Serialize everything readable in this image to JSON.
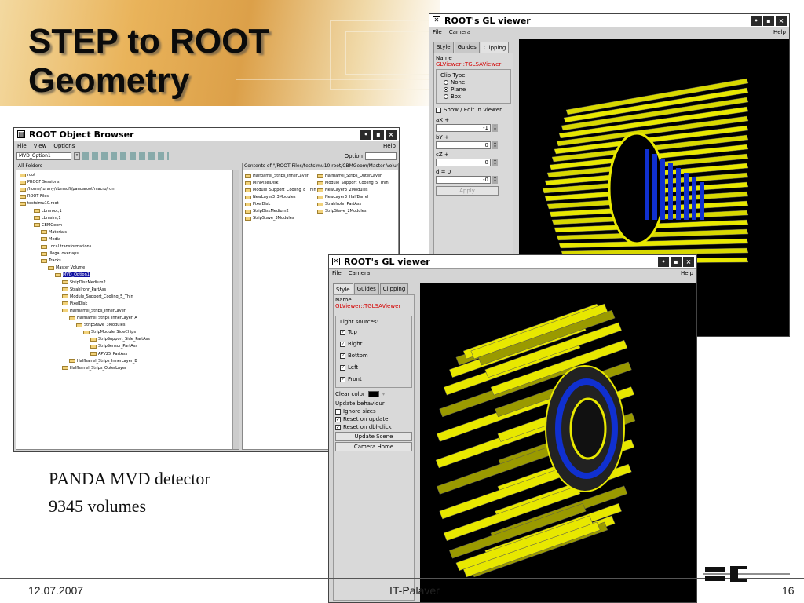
{
  "slide": {
    "title_line1": "STEP to ROOT",
    "title_line2": "Geometry",
    "caption_line1": "PANDA MVD detector",
    "caption_line2": "9345 volumes",
    "date": "12.07.2007",
    "footer": "IT-Palaver",
    "page": "16",
    "logo": "SI"
  },
  "browser": {
    "title": "ROOT Object Browser",
    "menu": [
      "File",
      "View",
      "Options"
    ],
    "help": "Help",
    "combo": "MVD_Option1",
    "option_label": "Option",
    "left_header": "All Folders",
    "right_header": "Contents of \"/ROOT Files/testsimu10.root/CBMGeom/Master Volume",
    "tree": [
      "root",
      "PROOF Sessions",
      "/home/turany/cbmsoft/pandaroot/macro/run",
      "ROOT Files",
      "testsimu10.root",
      "cbmroot;1",
      "cbmsim;1",
      "CBMGeom",
      "Materials",
      "Media",
      "Local transformations",
      "Illegal overlaps",
      "Tracks",
      "Master Volume",
      "MVD_Option1",
      "StripDiskMedium2",
      "Strahlrohr_PartAss",
      "Module_Support_Cooling_5_Thin",
      "PixelDisk",
      "Halfbarrel_Strips_InnerLayer",
      "Halfbarrel_Strips_InnerLayer_A",
      "StripStave_3Modules",
      "StripModule_SideChips",
      "StripSupport_Side_PartAss",
      "StripSensor_PartAss",
      "APV25_PartAss",
      "Halfbarrel_Strips_InnerLayer_B",
      "Halfbarrel_Strips_OuterLayer"
    ],
    "contents": [
      "Halfbarrel_Strips_InnerLayer",
      "Halfbarrel_Strips_OuterLayer",
      "MiniPixelDisk",
      "Module_Support_Cooling_5_Thin",
      "Module_Support_Cooling_8_Thin",
      "NewLayer3_2Modules",
      "NewLayer3_3Modules",
      "NewLayer3_HalfBarrel",
      "PixelDisk",
      "Strahlrohr_PartAss",
      "StripDiskMedium2",
      "StripStave_2Modules",
      "StripStave_3Modules"
    ]
  },
  "gl1": {
    "title": "ROOT's GL viewer",
    "menu": [
      "File",
      "Camera"
    ],
    "help": "Help",
    "tabs": [
      "Style",
      "Guides",
      "Clipping"
    ],
    "name_label": "Name",
    "name_value": "GLViewer::TGLSAViewer",
    "clip_type": "Clip Type",
    "options": [
      "None",
      "Plane",
      "Box"
    ],
    "show_edit": "Show / Edit In Viewer",
    "ax": "aX +",
    "ax_val": "-1",
    "by": "bY +",
    "by_val": "0",
    "cz": "cZ +",
    "cz_val": "0",
    "d": "d = 0",
    "d_val": "-0",
    "apply": "Apply"
  },
  "gl2": {
    "title": "ROOT's GL viewer",
    "menu": [
      "File",
      "Camera"
    ],
    "help": "Help",
    "tabs": [
      "Style",
      "Guides",
      "Clipping"
    ],
    "name_label": "Name",
    "name_value": "GLViewer::TGLSAViewer",
    "light_sources": "Light sources:",
    "lights": [
      "Top",
      "Right",
      "Bottom",
      "Left",
      "Front"
    ],
    "clear_color": "Clear color",
    "update_behaviour": "Update behaviour",
    "ignore_sizes": "Ignore sizes",
    "reset_update": "Reset on update",
    "reset_dbl": "Reset on dbl-click",
    "update_scene": "Update Scene",
    "camera_home": "Camera Home"
  },
  "colors": {
    "detector": "#e8e800",
    "detector_dark": "#9a9a00",
    "inner": "#1030d0",
    "canvas": "#000000"
  }
}
